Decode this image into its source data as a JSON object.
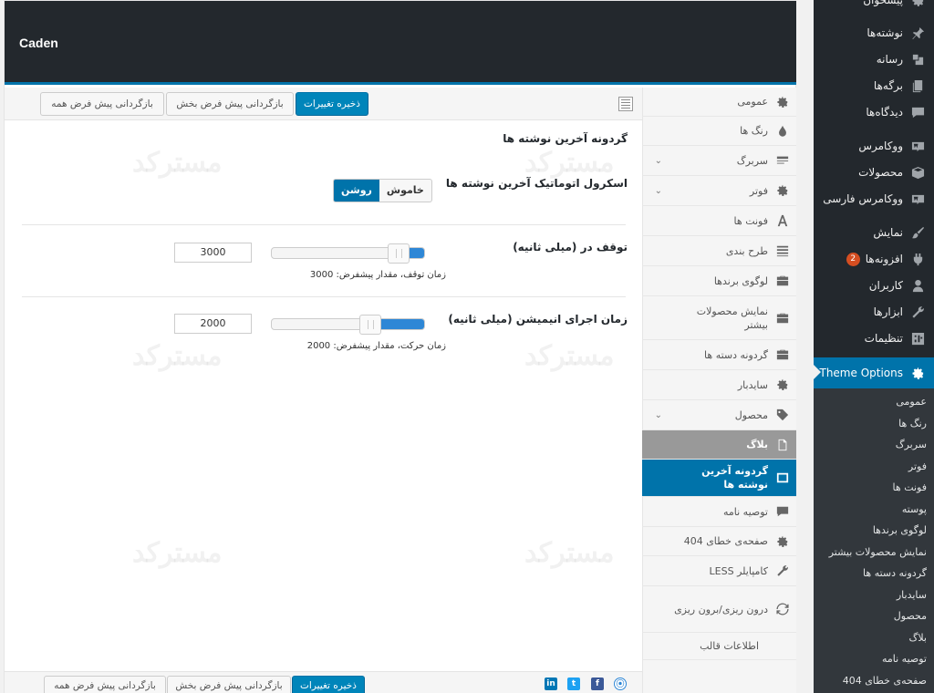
{
  "header": {
    "title": "Caden"
  },
  "toolbar": {
    "save_label": "ذخیره تغییرات",
    "reset_section_label": "بازگردانی پیش فرض بخش",
    "reset_all_label": "بازگردانی پیش فرض همه"
  },
  "section": {
    "title": "گردونه آخرین نوشته ها",
    "autoscroll": {
      "label": "اسکرول اتوماتیک آخرین نوشته ها",
      "on_label": "روشن",
      "off_label": "خاموش",
      "state": "on"
    },
    "pause": {
      "label": "توقف در (میلی ثانیه)",
      "value": "3000",
      "hint": "زمان توقف، مقدار پیشفرض: 3000",
      "slider_fraction": 0.18
    },
    "animation": {
      "label": "زمان اجرای انیمیشن (میلی ثانیه)",
      "value": "2000",
      "hint": "زمان حرکت، مقدار پیشفرض: 2000",
      "slider_fraction": 0.36
    }
  },
  "options_nav": [
    {
      "label": "عمومی",
      "icon": "gear-icon"
    },
    {
      "label": "رنگ ها",
      "icon": "drop-icon"
    },
    {
      "label": "سربرگ",
      "icon": "header-icon",
      "expand": true
    },
    {
      "label": "فوتر",
      "icon": "gear-icon",
      "expand": true
    },
    {
      "label": "فونت ها",
      "icon": "font-icon"
    },
    {
      "label": "طرح بندی",
      "icon": "list-icon"
    },
    {
      "label": "لوگوی برندها",
      "icon": "briefcase-icon"
    },
    {
      "label": "نمایش محصولات بیشتر",
      "icon": "briefcase-icon"
    },
    {
      "label": "گردونه دسته ها",
      "icon": "briefcase-icon"
    },
    {
      "label": "سایدبار",
      "icon": "gear-icon"
    },
    {
      "label": "محصول",
      "icon": "tag-icon",
      "expand": true
    },
    {
      "label": "بلاگ",
      "icon": "page-icon"
    },
    {
      "label": "گردونه آخرین نوشته ها",
      "icon": "window-icon"
    },
    {
      "label": "توصیه نامه",
      "icon": "comment-icon"
    },
    {
      "label": "صفحه‌ی خطای 404",
      "icon": "gear-icon"
    },
    {
      "label": "کامپایلر LESS",
      "icon": "wrench-icon"
    },
    {
      "label": "درون ریزی/برون ریزی",
      "icon": "refresh-icon"
    },
    {
      "label": "اطلاعات قالب",
      "icon": ""
    }
  ],
  "wp_menu": {
    "top_cut_label": "پیشخوان",
    "items": [
      {
        "label": "نوشته‌ها",
        "icon": "pin-icon"
      },
      {
        "label": "رسانه",
        "icon": "media-icon"
      },
      {
        "label": "برگه‌ها",
        "icon": "pages-icon"
      },
      {
        "label": "دیدگاه‌ها",
        "icon": "comments-icon"
      },
      {
        "label": "ووکامرس",
        "icon": "woo-icon"
      },
      {
        "label": "محصولات",
        "icon": "box-icon"
      },
      {
        "label": "ووکامرس فارسی",
        "icon": "woo-icon"
      },
      {
        "label": "نمایش",
        "icon": "brush-icon"
      },
      {
        "label": "افزونه‌ها",
        "icon": "plugin-icon",
        "badge": "2"
      },
      {
        "label": "کاربران",
        "icon": "user-icon"
      },
      {
        "label": "ابزارها",
        "icon": "tools-icon"
      },
      {
        "label": "تنظیمات",
        "icon": "settings-icon"
      }
    ],
    "active": {
      "label": "Theme Options",
      "icon": "gear-icon"
    },
    "submenu": [
      "عمومی",
      "رنگ ها",
      "سربرگ",
      "فوتر",
      "فونت ها",
      "پوسته",
      "لوگوی برندها",
      "نمایش محصولات بیشتر",
      "گردونه دسته ها",
      "سایدبار",
      "محصول",
      "بلاگ",
      "توصیه نامه",
      "صفحه‌ی خطای 404"
    ]
  },
  "watermark": "مسترکد",
  "social": [
    "linkedin-icon",
    "twitter-icon",
    "facebook-icon",
    "shield-icon"
  ]
}
